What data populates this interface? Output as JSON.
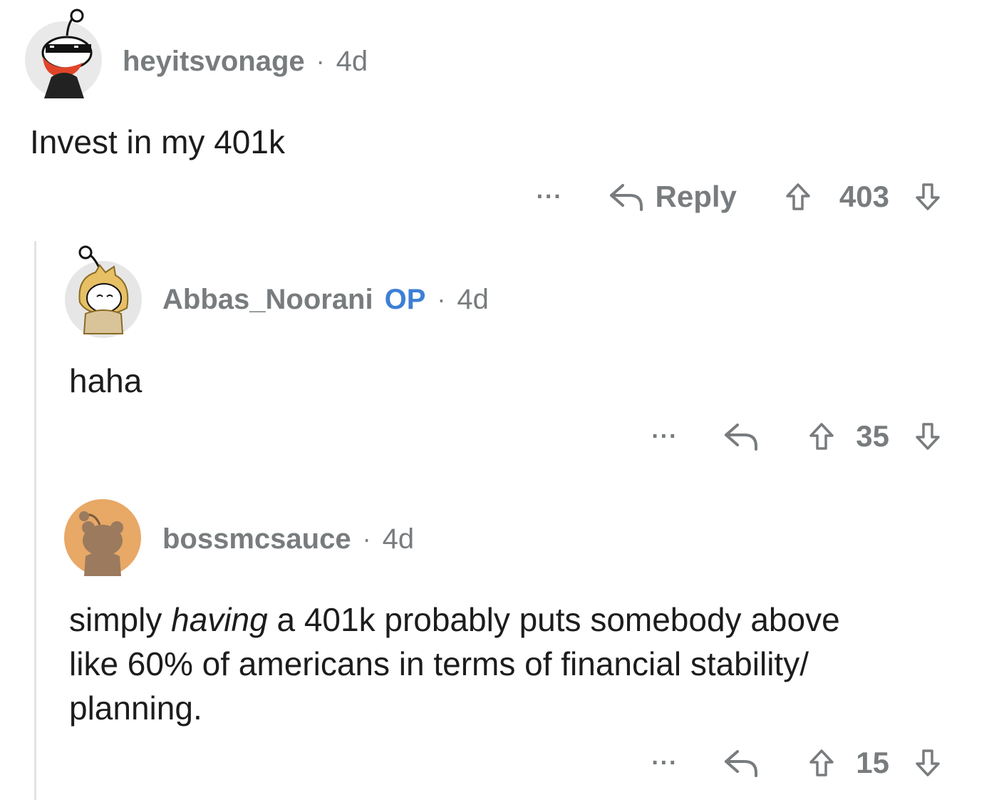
{
  "comments": [
    {
      "username": "heyitsvonage",
      "separator": "·",
      "age": "4d",
      "body": "Invest in my 401k",
      "more_label": "···",
      "reply_label": "Reply",
      "score": "403",
      "avatar_icon": "snoo-sunglasses-avatar"
    },
    {
      "username": "Abbas_Noorani",
      "op_badge": "OP",
      "separator": "·",
      "age": "4d",
      "body": "haha",
      "more_label": "···",
      "score": "35",
      "avatar_icon": "snoo-doge-hood-avatar"
    },
    {
      "username": "bossmcsauce",
      "separator": "·",
      "age": "4d",
      "body_pre": "simply ",
      "body_em": "having",
      "body_post_line1": " a 401k probably puts somebody above",
      "body_line2": "like 60% of americans in terms of financial stability/",
      "body_line3": "planning.",
      "more_label": "···",
      "score": "15",
      "avatar_icon": "snoo-bear-avatar"
    }
  ],
  "colors": {
    "meta_gray": "#787c7e",
    "op_blue": "#3d7fd6",
    "text": "#1c1c1c",
    "thread_line": "#e3e3e3",
    "bear_avatar_bg": "#e8a866"
  }
}
